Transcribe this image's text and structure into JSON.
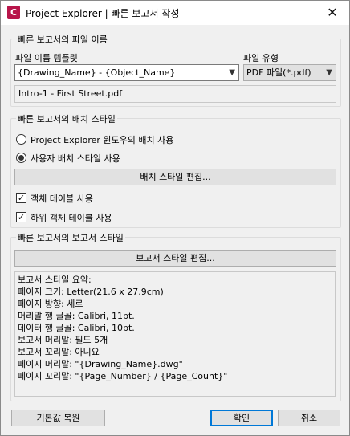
{
  "window": {
    "title": "Project Explorer | 빠른 보고서 작성",
    "icon_letter": "C",
    "close_glyph": "✕"
  },
  "filename_group": {
    "title": "빠른 보고서의 파일 이름",
    "template_label": "파일 이름 템플릿",
    "template_value": "{Drawing_Name} - {Object_Name}",
    "type_label": "파일 유형",
    "type_value": "PDF 파일(*.pdf)",
    "preview_value": "Intro-1 - First Street.pdf"
  },
  "layout_group": {
    "title": "빠른 보고서의 배치 스타일",
    "option_pe": "Project Explorer 윈도우의 배치 사용",
    "option_user": "사용자 배치 스타일 사용",
    "selected": "option_user",
    "edit_button": "배치 스타일 편집...",
    "use_object_tables": "객체 테이블 사용",
    "use_sub_object_tables": "하위 객체 테이블 사용",
    "use_object_tables_checked": true,
    "use_sub_object_tables_checked": true
  },
  "report_group": {
    "title": "빠른 보고서의 보고서 스타일",
    "edit_button": "보고서 스타일 편집...",
    "summary_lines": [
      "보고서 스타일 요약:",
      "   페이지 크기: Letter(21.6 x 27.9cm)",
      "   페이지 방향: 세로",
      "   머리말 행 글꼴: Calibri, 11pt.",
      "   데이터 행 글꼴: Calibri, 10pt.",
      "   보고서 머리말: 필드 5개",
      "   보고서 꼬리말: 아니요",
      "   페이지 머리말: \"{Drawing_Name}.dwg\"",
      "   페이지 꼬리말: \"{Page_Number} / {Page_Count}\""
    ]
  },
  "footer": {
    "reset_button": "기본값 복원",
    "ok_button": "확인",
    "cancel_button": "취소"
  },
  "icons": {
    "dropdown": "chevron-down-icon",
    "check": "checkmark-icon"
  }
}
